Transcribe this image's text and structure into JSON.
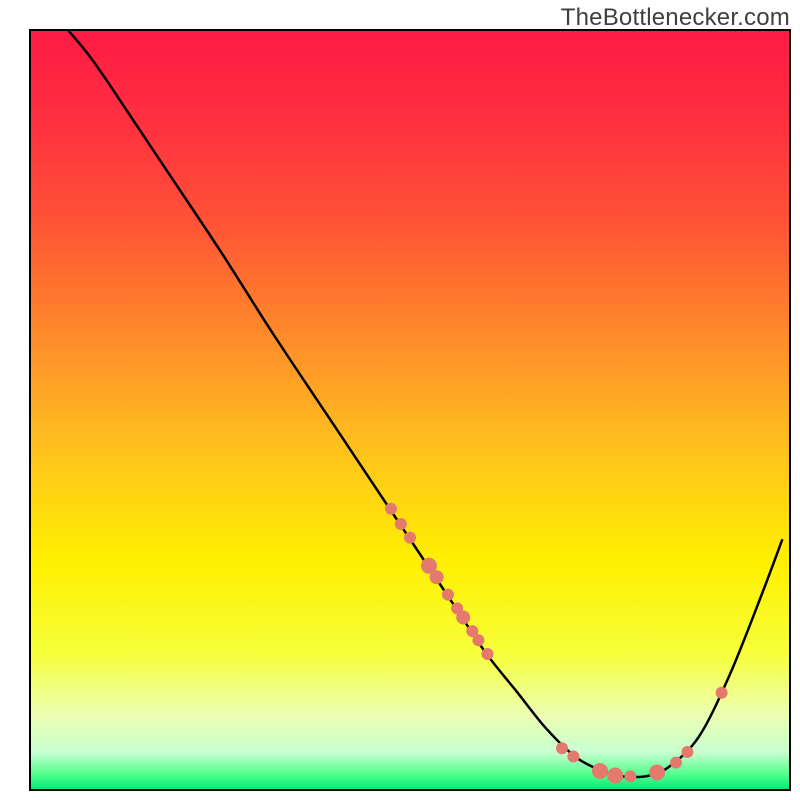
{
  "watermark": "TheBottlenecker.com",
  "chart_data": {
    "type": "line",
    "xlim": [
      0,
      100
    ],
    "ylim": [
      0,
      100
    ],
    "title": "",
    "xlabel": "",
    "ylabel": "",
    "series": [
      {
        "name": "curve",
        "points": [
          {
            "x": 5.0,
            "y": 100.0
          },
          {
            "x": 7.5,
            "y": 97.0
          },
          {
            "x": 10.0,
            "y": 93.5
          },
          {
            "x": 12.0,
            "y": 90.5
          },
          {
            "x": 14.0,
            "y": 87.5
          },
          {
            "x": 18.0,
            "y": 81.5
          },
          {
            "x": 25.0,
            "y": 71.0
          },
          {
            "x": 32.0,
            "y": 60.0
          },
          {
            "x": 40.0,
            "y": 48.0
          },
          {
            "x": 48.0,
            "y": 36.0
          },
          {
            "x": 52.0,
            "y": 30.0
          },
          {
            "x": 56.0,
            "y": 24.0
          },
          {
            "x": 60.0,
            "y": 18.0
          },
          {
            "x": 64.0,
            "y": 13.0
          },
          {
            "x": 68.0,
            "y": 8.0
          },
          {
            "x": 72.0,
            "y": 4.2
          },
          {
            "x": 76.0,
            "y": 2.2
          },
          {
            "x": 78.0,
            "y": 1.8
          },
          {
            "x": 81.0,
            "y": 1.8
          },
          {
            "x": 84.0,
            "y": 3.0
          },
          {
            "x": 88.0,
            "y": 7.0
          },
          {
            "x": 92.0,
            "y": 15.0
          },
          {
            "x": 96.0,
            "y": 25.0
          },
          {
            "x": 99.0,
            "y": 33.0
          }
        ]
      }
    ],
    "markers": [
      {
        "x": 47.5,
        "y": 37.0,
        "r": 6
      },
      {
        "x": 48.8,
        "y": 35.0,
        "r": 6
      },
      {
        "x": 50.0,
        "y": 33.2,
        "r": 6
      },
      {
        "x": 52.5,
        "y": 29.5,
        "r": 8
      },
      {
        "x": 53.5,
        "y": 28.0,
        "r": 7
      },
      {
        "x": 55.0,
        "y": 25.7,
        "r": 6
      },
      {
        "x": 56.2,
        "y": 23.9,
        "r": 6
      },
      {
        "x": 57.0,
        "y": 22.7,
        "r": 7
      },
      {
        "x": 58.2,
        "y": 20.9,
        "r": 6
      },
      {
        "x": 59.0,
        "y": 19.7,
        "r": 6
      },
      {
        "x": 60.2,
        "y": 17.9,
        "r": 6
      },
      {
        "x": 70.0,
        "y": 5.5,
        "r": 6
      },
      {
        "x": 71.5,
        "y": 4.4,
        "r": 6
      },
      {
        "x": 75.0,
        "y": 2.5,
        "r": 8
      },
      {
        "x": 77.0,
        "y": 1.9,
        "r": 8
      },
      {
        "x": 79.0,
        "y": 1.8,
        "r": 6
      },
      {
        "x": 82.5,
        "y": 2.3,
        "r": 8
      },
      {
        "x": 85.0,
        "y": 3.6,
        "r": 6
      },
      {
        "x": 86.5,
        "y": 5.0,
        "r": 6
      },
      {
        "x": 91.0,
        "y": 12.8,
        "r": 6
      }
    ],
    "gradient_stops": [
      {
        "offset": 0.0,
        "color": "#ff1a45"
      },
      {
        "offset": 0.12,
        "color": "#ff3040"
      },
      {
        "offset": 0.25,
        "color": "#ff5236"
      },
      {
        "offset": 0.4,
        "color": "#ff8a2a"
      },
      {
        "offset": 0.55,
        "color": "#ffc11e"
      },
      {
        "offset": 0.7,
        "color": "#fff000"
      },
      {
        "offset": 0.82,
        "color": "#f6ff3a"
      },
      {
        "offset": 0.9,
        "color": "#ecffb0"
      },
      {
        "offset": 0.95,
        "color": "#c9ffd0"
      },
      {
        "offset": 0.98,
        "color": "#4fff8c"
      },
      {
        "offset": 1.0,
        "color": "#00e878"
      }
    ],
    "marker_color": "#e47a6e",
    "curve_color": "#000000"
  }
}
